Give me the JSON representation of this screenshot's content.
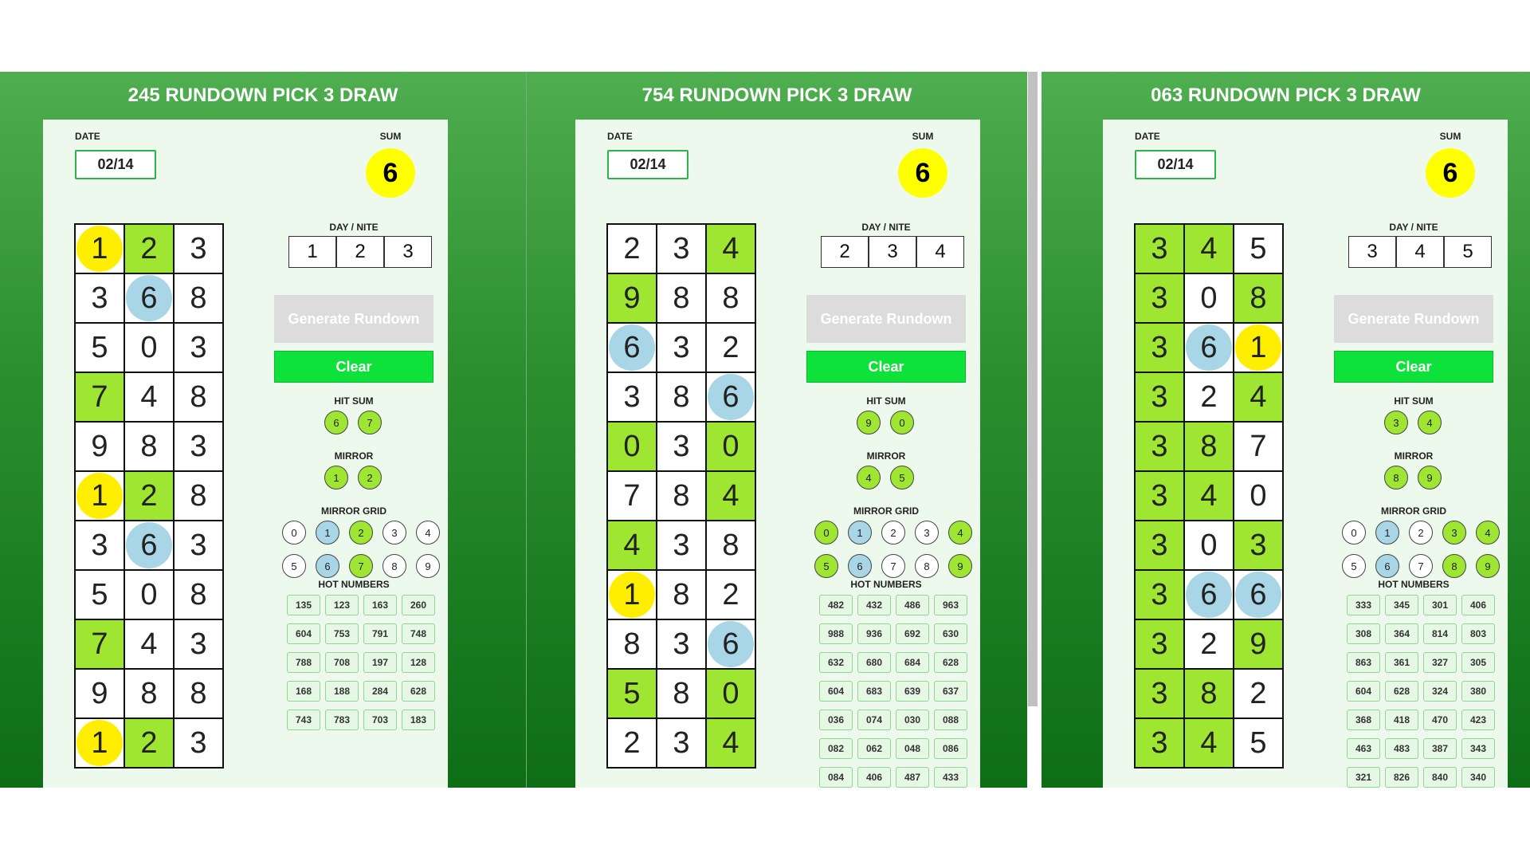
{
  "labels": {
    "date": "DATE",
    "sum": "SUM",
    "day_nite": "DAY / NITE",
    "generate": "Generate Rundown",
    "clear": "Clear",
    "hit_sum": "HIT SUM",
    "mirror": "MIRROR",
    "mirror_grid": "MIRROR GRID",
    "hot_numbers": "HOT NUMBERS"
  },
  "colors": {
    "green_cell": "#9ee632",
    "yellow_highlight": "#ffee00",
    "blue_highlight": "#a8d6e6",
    "clear_button": "#0ee13a"
  },
  "panels": [
    {
      "title": "245 RUNDOWN PICK 3 DRAW",
      "date": "02/14",
      "sum": "6",
      "day_nite": [
        "1",
        "2",
        "3"
      ],
      "hit_sum": [
        "6",
        "7"
      ],
      "mirror": [
        "1",
        "2"
      ],
      "mirror_grid": [
        {
          "v": "0",
          "c": "w"
        },
        {
          "v": "1",
          "c": "b"
        },
        {
          "v": "2",
          "c": "g"
        },
        {
          "v": "3",
          "c": "w"
        },
        {
          "v": "4",
          "c": "w"
        },
        {
          "v": "5",
          "c": "w"
        },
        {
          "v": "6",
          "c": "b"
        },
        {
          "v": "7",
          "c": "g"
        },
        {
          "v": "8",
          "c": "w"
        },
        {
          "v": "9",
          "c": "w"
        }
      ],
      "hot_numbers": [
        "135",
        "123",
        "163",
        "260",
        "604",
        "753",
        "791",
        "748",
        "788",
        "708",
        "197",
        "128",
        "168",
        "188",
        "284",
        "628",
        "743",
        "783",
        "703",
        "183"
      ],
      "grid": [
        [
          {
            "v": "1",
            "bg": "w",
            "hl": "y"
          },
          {
            "v": "2",
            "bg": "g",
            "hl": ""
          },
          {
            "v": "3",
            "bg": "w",
            "hl": ""
          }
        ],
        [
          {
            "v": "3",
            "bg": "w",
            "hl": ""
          },
          {
            "v": "6",
            "bg": "w",
            "hl": "b"
          },
          {
            "v": "8",
            "bg": "w",
            "hl": ""
          }
        ],
        [
          {
            "v": "5",
            "bg": "w",
            "hl": ""
          },
          {
            "v": "0",
            "bg": "w",
            "hl": ""
          },
          {
            "v": "3",
            "bg": "w",
            "hl": ""
          }
        ],
        [
          {
            "v": "7",
            "bg": "g",
            "hl": ""
          },
          {
            "v": "4",
            "bg": "w",
            "hl": ""
          },
          {
            "v": "8",
            "bg": "w",
            "hl": ""
          }
        ],
        [
          {
            "v": "9",
            "bg": "w",
            "hl": ""
          },
          {
            "v": "8",
            "bg": "w",
            "hl": ""
          },
          {
            "v": "3",
            "bg": "w",
            "hl": ""
          }
        ],
        [
          {
            "v": "1",
            "bg": "w",
            "hl": "y"
          },
          {
            "v": "2",
            "bg": "g",
            "hl": ""
          },
          {
            "v": "8",
            "bg": "w",
            "hl": ""
          }
        ],
        [
          {
            "v": "3",
            "bg": "w",
            "hl": ""
          },
          {
            "v": "6",
            "bg": "w",
            "hl": "b"
          },
          {
            "v": "3",
            "bg": "w",
            "hl": ""
          }
        ],
        [
          {
            "v": "5",
            "bg": "w",
            "hl": ""
          },
          {
            "v": "0",
            "bg": "w",
            "hl": ""
          },
          {
            "v": "8",
            "bg": "w",
            "hl": ""
          }
        ],
        [
          {
            "v": "7",
            "bg": "g",
            "hl": ""
          },
          {
            "v": "4",
            "bg": "w",
            "hl": ""
          },
          {
            "v": "3",
            "bg": "w",
            "hl": ""
          }
        ],
        [
          {
            "v": "9",
            "bg": "w",
            "hl": ""
          },
          {
            "v": "8",
            "bg": "w",
            "hl": ""
          },
          {
            "v": "8",
            "bg": "w",
            "hl": ""
          }
        ],
        [
          {
            "v": "1",
            "bg": "w",
            "hl": "y"
          },
          {
            "v": "2",
            "bg": "g",
            "hl": ""
          },
          {
            "v": "3",
            "bg": "w",
            "hl": ""
          }
        ]
      ]
    },
    {
      "title": "754 RUNDOWN PICK 3 DRAW",
      "date": "02/14",
      "sum": "6",
      "day_nite": [
        "2",
        "3",
        "4"
      ],
      "hit_sum": [
        "9",
        "0"
      ],
      "mirror": [
        "4",
        "5"
      ],
      "mirror_grid": [
        {
          "v": "0",
          "c": "g"
        },
        {
          "v": "1",
          "c": "b"
        },
        {
          "v": "2",
          "c": "w"
        },
        {
          "v": "3",
          "c": "w"
        },
        {
          "v": "4",
          "c": "g"
        },
        {
          "v": "5",
          "c": "g"
        },
        {
          "v": "6",
          "c": "b"
        },
        {
          "v": "7",
          "c": "w"
        },
        {
          "v": "8",
          "c": "w"
        },
        {
          "v": "9",
          "c": "g"
        }
      ],
      "hot_numbers": [
        "482",
        "432",
        "486",
        "963",
        "988",
        "936",
        "692",
        "630",
        "632",
        "680",
        "684",
        "628",
        "604",
        "683",
        "639",
        "637",
        "036",
        "074",
        "030",
        "088",
        "082",
        "062",
        "048",
        "086",
        "084",
        "406",
        "487",
        "433"
      ],
      "grid": [
        [
          {
            "v": "2",
            "bg": "w",
            "hl": ""
          },
          {
            "v": "3",
            "bg": "w",
            "hl": ""
          },
          {
            "v": "4",
            "bg": "g",
            "hl": ""
          }
        ],
        [
          {
            "v": "9",
            "bg": "g",
            "hl": ""
          },
          {
            "v": "8",
            "bg": "w",
            "hl": ""
          },
          {
            "v": "8",
            "bg": "w",
            "hl": ""
          }
        ],
        [
          {
            "v": "6",
            "bg": "w",
            "hl": "b"
          },
          {
            "v": "3",
            "bg": "w",
            "hl": ""
          },
          {
            "v": "2",
            "bg": "w",
            "hl": ""
          }
        ],
        [
          {
            "v": "3",
            "bg": "w",
            "hl": ""
          },
          {
            "v": "8",
            "bg": "w",
            "hl": ""
          },
          {
            "v": "6",
            "bg": "w",
            "hl": "b"
          }
        ],
        [
          {
            "v": "0",
            "bg": "g",
            "hl": ""
          },
          {
            "v": "3",
            "bg": "w",
            "hl": ""
          },
          {
            "v": "0",
            "bg": "g",
            "hl": ""
          }
        ],
        [
          {
            "v": "7",
            "bg": "w",
            "hl": ""
          },
          {
            "v": "8",
            "bg": "w",
            "hl": ""
          },
          {
            "v": "4",
            "bg": "g",
            "hl": ""
          }
        ],
        [
          {
            "v": "4",
            "bg": "g",
            "hl": ""
          },
          {
            "v": "3",
            "bg": "w",
            "hl": ""
          },
          {
            "v": "8",
            "bg": "w",
            "hl": ""
          }
        ],
        [
          {
            "v": "1",
            "bg": "w",
            "hl": "y"
          },
          {
            "v": "8",
            "bg": "w",
            "hl": ""
          },
          {
            "v": "2",
            "bg": "w",
            "hl": ""
          }
        ],
        [
          {
            "v": "8",
            "bg": "w",
            "hl": ""
          },
          {
            "v": "3",
            "bg": "w",
            "hl": ""
          },
          {
            "v": "6",
            "bg": "w",
            "hl": "b"
          }
        ],
        [
          {
            "v": "5",
            "bg": "g",
            "hl": ""
          },
          {
            "v": "8",
            "bg": "w",
            "hl": ""
          },
          {
            "v": "0",
            "bg": "g",
            "hl": ""
          }
        ],
        [
          {
            "v": "2",
            "bg": "w",
            "hl": ""
          },
          {
            "v": "3",
            "bg": "w",
            "hl": ""
          },
          {
            "v": "4",
            "bg": "g",
            "hl": ""
          }
        ]
      ]
    },
    {
      "title": "063 RUNDOWN PICK 3 DRAW",
      "date": "02/14",
      "sum": "6",
      "day_nite": [
        "3",
        "4",
        "5"
      ],
      "hit_sum": [
        "3",
        "4"
      ],
      "mirror": [
        "8",
        "9"
      ],
      "mirror_grid": [
        {
          "v": "0",
          "c": "w"
        },
        {
          "v": "1",
          "c": "b"
        },
        {
          "v": "2",
          "c": "w"
        },
        {
          "v": "3",
          "c": "g"
        },
        {
          "v": "4",
          "c": "g"
        },
        {
          "v": "5",
          "c": "w"
        },
        {
          "v": "6",
          "c": "b"
        },
        {
          "v": "7",
          "c": "w"
        },
        {
          "v": "8",
          "c": "g"
        },
        {
          "v": "9",
          "c": "g"
        }
      ],
      "hot_numbers": [
        "333",
        "345",
        "301",
        "406",
        "308",
        "364",
        "814",
        "803",
        "863",
        "361",
        "327",
        "305",
        "604",
        "628",
        "324",
        "380",
        "368",
        "418",
        "470",
        "423",
        "463",
        "483",
        "387",
        "343",
        "321",
        "826",
        "840",
        "340"
      ],
      "grid": [
        [
          {
            "v": "3",
            "bg": "g",
            "hl": ""
          },
          {
            "v": "4",
            "bg": "g",
            "hl": ""
          },
          {
            "v": "5",
            "bg": "w",
            "hl": ""
          }
        ],
        [
          {
            "v": "3",
            "bg": "g",
            "hl": ""
          },
          {
            "v": "0",
            "bg": "w",
            "hl": ""
          },
          {
            "v": "8",
            "bg": "g",
            "hl": ""
          }
        ],
        [
          {
            "v": "3",
            "bg": "g",
            "hl": ""
          },
          {
            "v": "6",
            "bg": "w",
            "hl": "b"
          },
          {
            "v": "1",
            "bg": "w",
            "hl": "y"
          }
        ],
        [
          {
            "v": "3",
            "bg": "g",
            "hl": ""
          },
          {
            "v": "2",
            "bg": "w",
            "hl": ""
          },
          {
            "v": "4",
            "bg": "g",
            "hl": ""
          }
        ],
        [
          {
            "v": "3",
            "bg": "g",
            "hl": ""
          },
          {
            "v": "8",
            "bg": "g",
            "hl": ""
          },
          {
            "v": "7",
            "bg": "w",
            "hl": ""
          }
        ],
        [
          {
            "v": "3",
            "bg": "g",
            "hl": ""
          },
          {
            "v": "4",
            "bg": "g",
            "hl": ""
          },
          {
            "v": "0",
            "bg": "w",
            "hl": ""
          }
        ],
        [
          {
            "v": "3",
            "bg": "g",
            "hl": ""
          },
          {
            "v": "0",
            "bg": "w",
            "hl": ""
          },
          {
            "v": "3",
            "bg": "g",
            "hl": ""
          }
        ],
        [
          {
            "v": "3",
            "bg": "g",
            "hl": ""
          },
          {
            "v": "6",
            "bg": "w",
            "hl": "b"
          },
          {
            "v": "6",
            "bg": "w",
            "hl": "b"
          }
        ],
        [
          {
            "v": "3",
            "bg": "g",
            "hl": ""
          },
          {
            "v": "2",
            "bg": "w",
            "hl": ""
          },
          {
            "v": "9",
            "bg": "g",
            "hl": ""
          }
        ],
        [
          {
            "v": "3",
            "bg": "g",
            "hl": ""
          },
          {
            "v": "8",
            "bg": "g",
            "hl": ""
          },
          {
            "v": "2",
            "bg": "w",
            "hl": ""
          }
        ],
        [
          {
            "v": "3",
            "bg": "g",
            "hl": ""
          },
          {
            "v": "4",
            "bg": "g",
            "hl": ""
          },
          {
            "v": "5",
            "bg": "w",
            "hl": ""
          }
        ]
      ]
    }
  ]
}
